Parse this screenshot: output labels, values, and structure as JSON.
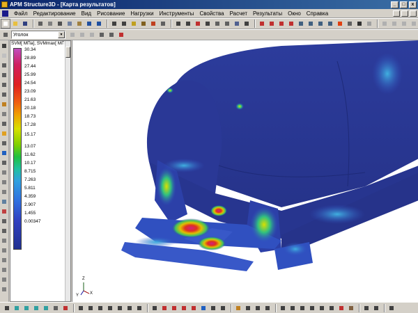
{
  "window": {
    "title": "APM Structure3D - [Карта результатов]",
    "minimize_glyph": "_",
    "maximize_glyph": "□",
    "close_glyph": "x"
  },
  "menu": {
    "items": [
      "Файл",
      "Редактирование",
      "Вид",
      "Рисование",
      "Нагрузки",
      "Инструменты",
      "Свойства",
      "Расчет",
      "Результаты",
      "Окно",
      "Справка"
    ]
  },
  "toolbar2": {
    "section_select_value": "Уголок"
  },
  "legend": {
    "title": "SVM[ МПа], SVMmax[ МПа]",
    "ticks": [
      "30.34",
      "28.89",
      "27.44",
      "25.99",
      "24.54",
      "23.09",
      "21.63",
      "20.18",
      "18.73",
      "17.28",
      "15.17",
      "13.07",
      "11.62",
      "10.17",
      "8.715",
      "7.263",
      "5.811",
      "4.359",
      "2.907",
      "1.455",
      "0.00347"
    ],
    "colors": {
      "max": "#c050c0",
      "high": "#e02020",
      "mid": "#80d000",
      "low": "#30a0e0",
      "min": "#203090"
    }
  },
  "viewport": {
    "axis_z": "Z",
    "axis_x": "X",
    "axis_y": "Y",
    "model_color": "#2b3a9a"
  }
}
